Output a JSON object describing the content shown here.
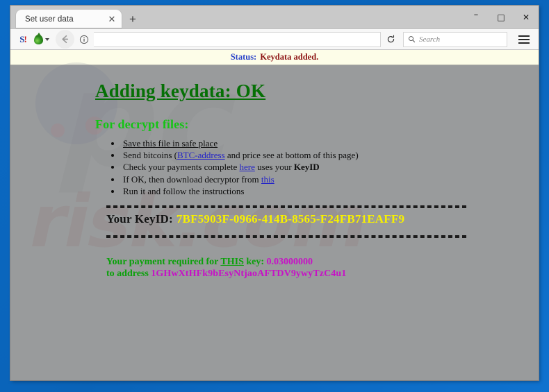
{
  "window": {
    "controls": {
      "minimize": "–",
      "maximize": "□",
      "close": "✕"
    }
  },
  "tabs": {
    "items": [
      {
        "title": "Set user data",
        "close": "✕"
      }
    ],
    "new_tab": "+"
  },
  "toolbar": {
    "addon_s_letter": "S",
    "addon_s_bang": "!",
    "back_glyph": "←",
    "info_glyph": "ⓘ",
    "reload_glyph": "⟳",
    "url_value": "",
    "url_placeholder": "",
    "search_placeholder": "Search",
    "search_icon": "⚲"
  },
  "page": {
    "status": {
      "label": "Status:",
      "value": "Keydata added."
    },
    "headline": "Adding keydata: OK",
    "subhead": "For decrypt files:",
    "instructions": [
      {
        "parts": [
          {
            "text": "Save this file in safe place",
            "style": "underline"
          }
        ]
      },
      {
        "parts": [
          {
            "text": "Send bitcoins (",
            "style": "plain"
          },
          {
            "text": "BTC-address",
            "style": "link"
          },
          {
            "text": " and price see at bottom of this page)",
            "style": "plain"
          }
        ]
      },
      {
        "parts": [
          {
            "text": "Check your payments complete ",
            "style": "plain"
          },
          {
            "text": "here",
            "style": "link"
          },
          {
            "text": " uses your ",
            "style": "plain"
          },
          {
            "text": "KeyID",
            "style": "bold"
          }
        ]
      },
      {
        "parts": [
          {
            "text": "If OK, then download decryptor from ",
            "style": "plain"
          },
          {
            "text": "this",
            "style": "link"
          }
        ]
      },
      {
        "parts": [
          {
            "text": "Run it and follow the instructions",
            "style": "plain"
          }
        ]
      }
    ],
    "keyid": {
      "label": "Your KeyID:",
      "value": "7BF5903F-0966-414B-8565-F24FB71EAFF9"
    },
    "payment": {
      "line1_pre": "Your payment required for ",
      "line1_this": "THIS",
      "line1_mid": " key: ",
      "line1_amount": "0.03000000",
      "line2_pre": "to address ",
      "line2_address": "1GHwXtHFk9bEsyNtjaoAFTDV9ywyTzC4u1"
    },
    "watermark": {
      "big": "risk.com",
      "mark": "pc"
    }
  },
  "colors": {
    "desktop_blue": "#0a68c1",
    "page_gray": "#999b9c",
    "status_bg": "#fdfde8",
    "status_label": "#2b44c9",
    "status_value": "#8c1212",
    "headline_green": "#067006",
    "subhead_green": "#14c414",
    "keyid_yellow": "#f7f000",
    "payment_green": "#0aa10a",
    "payment_magenta": "#c612c6",
    "link_blue": "#2323c8"
  }
}
